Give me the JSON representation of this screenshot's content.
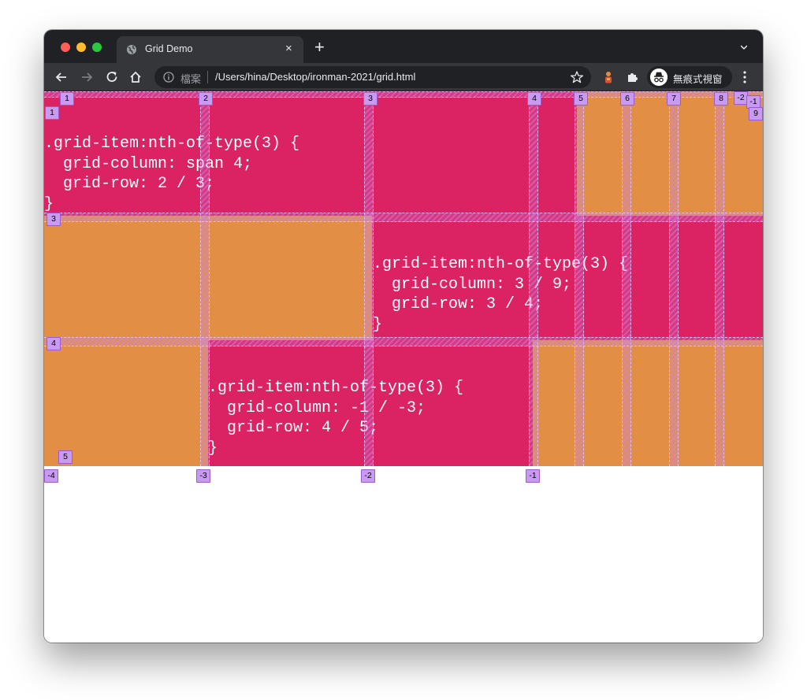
{
  "browser": {
    "tab_title": "Grid Demo",
    "tab_close": "×",
    "new_tab": "+",
    "url_label": "檔案",
    "url": "/Users/hina/Desktop/ironman-2021/grid.html",
    "incognito_label": "無痕式視窗"
  },
  "page": {
    "colors": {
      "primary": "#db2262",
      "secondary": "#e28f45",
      "grid_overlay": "#c99bf0"
    },
    "code_blocks": [
      ".grid-item:nth-of-type(3) {\n  grid-column: span 4;\n  grid-row: 2 / 3;\n}",
      ".grid-item:nth-of-type(3) {\n  grid-column: 3 / 9;\n  grid-row: 3 / 4;\n}",
      ".grid-item:nth-of-type(3) {\n  grid-column: -1 / -3;\n  grid-row: 4 / 5;\n}"
    ],
    "line_badges": {
      "col_top": [
        "1",
        "2",
        "3",
        "4",
        "5",
        "6",
        "7",
        "8",
        "-2",
        "-1"
      ],
      "col_side": [
        "9"
      ],
      "row_left": [
        "1",
        "3",
        "4",
        "5"
      ],
      "col_bottom": [
        "-4",
        "-3",
        "-2",
        "-1"
      ]
    }
  }
}
